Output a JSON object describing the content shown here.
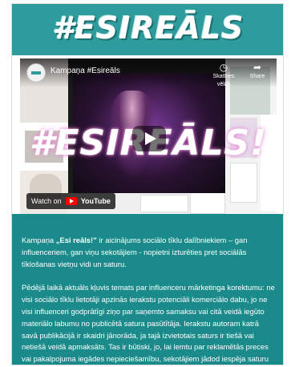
{
  "logo": {
    "text": "#ESIREĀLS"
  },
  "video": {
    "channel_title": "Kampaņa #Esireāls",
    "overlay_title": "#ESIREĀLS!",
    "actions": [
      {
        "icon": "clock-icon",
        "label": "Skatīties vēlāk"
      },
      {
        "icon": "share-icon",
        "label": "Share"
      }
    ],
    "watch_on_label": "Watch on",
    "youtube_label": "YouTube"
  },
  "article": {
    "p1_prefix": "Kampaņa ",
    "p1_bold": "„Esi reāls!”",
    "p1_rest": " ir aicinājums sociālo tīklu dalībniekiem – gan influenceriem, gan viņu sekotājiem - nopietni izturēties pret sociālās tīklošanas vietņu vidi un saturu.",
    "p2": "Pēdējā laikā aktuāls kļuvis temats par influenceru mārketinga korektumu: ne visi sociālo tīklu lietotāji apzinās ierakstu potenciāli komerciālo dabu, jo ne visi influenceri godprātīgi ziņo par saņemto samaksu vai citā veidā iegūto materiālo labumu no publicētā satura pasūtītāja. Ierakstu autoram katrā savā publikācijā ir skaidri jānorāda, ja tajā izvietotais saturs ir tiešā vai netiešā veidā apmaksāts. Tas ir būtiski, jo, lai lemtu par reklamētās preces vai pakalpojuma iegādes nepieciešamību, sekotājiem jādod iespēja saturu izvērtēt kritiski."
  }
}
